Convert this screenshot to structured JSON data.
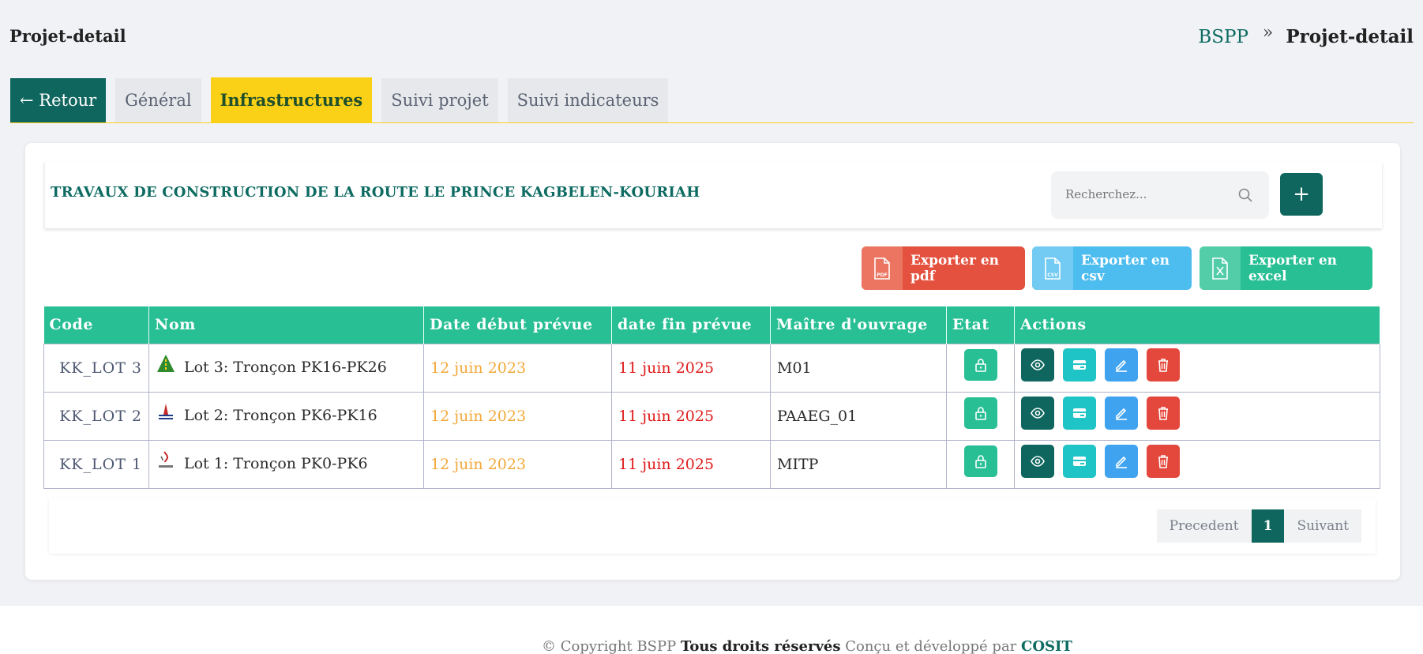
{
  "page_title": "Projet-detail",
  "breadcrumb": {
    "root": "BSPP",
    "separator": "»",
    "current": "Projet-detail"
  },
  "tabs": [
    {
      "label": "← Retour"
    },
    {
      "label": "Général"
    },
    {
      "label": "Infrastructures",
      "active": true
    },
    {
      "label": "Suivi projet"
    },
    {
      "label": "Suivi indicateurs"
    }
  ],
  "project": {
    "title": "TRAVAUX DE CONSTRUCTION DE LA ROUTE LE PRINCE KAGBELEN-KOURIAH"
  },
  "search": {
    "placeholder": "Recherchez...",
    "icon": "search-icon"
  },
  "add_button": {
    "label": "+"
  },
  "exports": {
    "pdf": "Exporter en pdf",
    "csv": "Exporter en csv",
    "excel": "Exporter en excel",
    "pdf_tag": "PDF",
    "csv_tag": "CSV"
  },
  "table": {
    "headers": [
      "Code",
      "Nom",
      "Date début prévue",
      "date fin prévue",
      "Maître d'ouvrage",
      "Etat",
      "Actions"
    ],
    "rows": [
      {
        "code": "KK_LOT 3",
        "name": "Lot 3: Tronçon PK16-PK26",
        "start": "12 juin 2023",
        "end": "11 juin 2025",
        "owner": "M01"
      },
      {
        "code": "KK_LOT 2",
        "name": "Lot 2: Tronçon PK6-PK16",
        "start": "12 juin 2023",
        "end": "11 juin 2025",
        "owner": "PAAEG_01"
      },
      {
        "code": "KK_LOT 1",
        "name": "Lot 1: Tronçon PK0-PK6",
        "start": "12 juin 2023",
        "end": "11 juin 2025",
        "owner": "MITP"
      }
    ]
  },
  "pagination": {
    "prev": "Precedent",
    "page": "1",
    "next": "Suivant"
  },
  "footer": {
    "prefix": "© Copyright BSPP",
    "rights": "Tous droits réservés",
    "middle": "Conçu et développé par",
    "company": "COSIT"
  },
  "colors": {
    "primary": "#0f665e",
    "accent": "#fbd117",
    "table_header": "#27bf93",
    "start_date": "#f2a93b",
    "end_date": "#e01b1b"
  }
}
